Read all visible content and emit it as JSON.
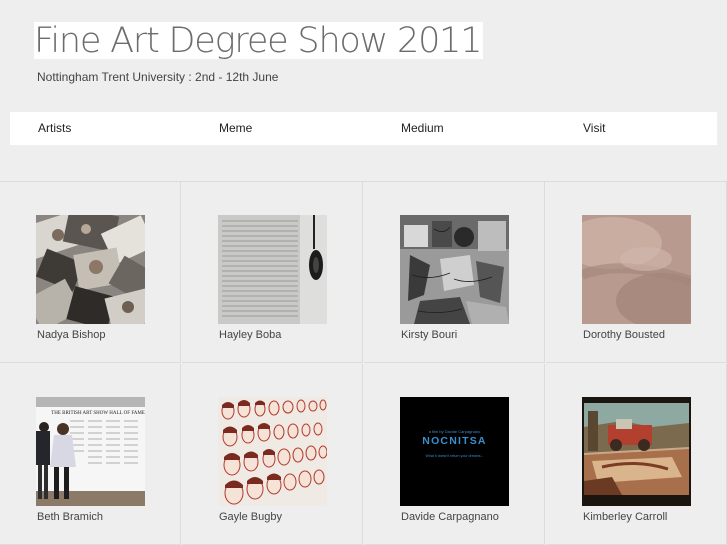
{
  "header": {
    "title": "Fine Art Degree Show 2011",
    "subtitle": "Nottingham Trent University : 2nd - 12th June"
  },
  "nav": {
    "items": [
      {
        "label": "Artists"
      },
      {
        "label": "Meme"
      },
      {
        "label": "Medium"
      },
      {
        "label": "Visit"
      }
    ]
  },
  "artists": [
    {
      "name": "Nadya Bishop",
      "thumb_icon": "collage-photo"
    },
    {
      "name": "Hayley Boba",
      "thumb_icon": "text-wall-photo"
    },
    {
      "name": "Kirsty Bouri",
      "thumb_icon": "drawing-photo"
    },
    {
      "name": "Dorothy Bousted",
      "thumb_icon": "skin-abstract-photo"
    },
    {
      "name": "Beth Bramich",
      "thumb_icon": "hall-of-fame-photo"
    },
    {
      "name": "Gayle Bugby",
      "thumb_icon": "faces-wall-photo"
    },
    {
      "name": "Davide Carpagnano",
      "thumb_icon": "film-title-card"
    },
    {
      "name": "Kimberley Carroll",
      "thumb_icon": "projection-photo"
    }
  ],
  "thumb_text": {
    "beth_sign": "THE BRITISH ART SHOW HALL OF FAME",
    "davide_film_by": "a film by Davide Carpagnano",
    "davide_title": "NOCNITSA",
    "davide_tagline": "What it doesn't return your dreams..."
  },
  "colors": {
    "background": "#eeeeef",
    "panel": "#ffffff",
    "title_text": "#6c6c6c",
    "grid_line": "#dcdcdc",
    "film_title": "#3a8fd0"
  }
}
